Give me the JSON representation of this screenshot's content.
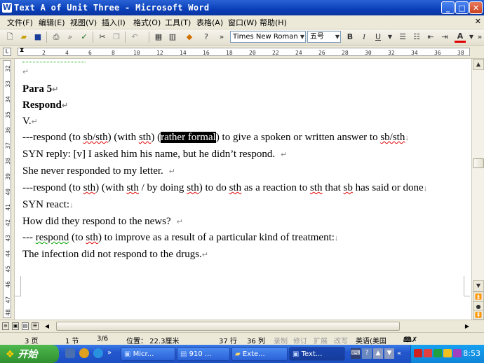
{
  "window": {
    "title": "Text A of Unit Three - Microsoft Word",
    "app_icon": "W",
    "minimize": "_",
    "maximize": "□",
    "close": "✕"
  },
  "menu": [
    "文件(F)",
    "编辑(E)",
    "视图(V)",
    "插入(I)",
    "格式(O)",
    "工具(T)",
    "表格(A)",
    "窗口(W)",
    "帮助(H)"
  ],
  "menu_close": "✕",
  "toolbar": {
    "font_name": "Times New Roman",
    "font_size": "五号",
    "bold": "B",
    "italic": "I",
    "underline": "U",
    "font_color": "A"
  },
  "ruler": {
    "ticks": [
      "2",
      "4",
      "6",
      "8",
      "10",
      "12",
      "14",
      "16",
      "18",
      "20",
      "22",
      "24",
      "26",
      "28",
      "30",
      "32",
      "34",
      "36",
      "38"
    ],
    "vticks": [
      "32",
      "33",
      "34",
      "35",
      "36",
      "37",
      "38",
      "39",
      "40",
      "41",
      "42",
      "43",
      "44",
      "45",
      "46",
      "47",
      "48"
    ]
  },
  "document": {
    "para_heading": "Para 5",
    "word_heading": "Respond",
    "pos": "V.",
    "def1_a": "---respond (to ",
    "def1_b": "sb/sth",
    "def1_c": ") (with ",
    "def1_d": "sth",
    "def1_e": ") (",
    "def1_sel": "rather formal",
    "def1_f": ") to give a spoken or written answer to ",
    "def1_g": "sb/sth",
    "syn1": " SYN   reply: [v] I asked him his name, but he didn’t respond.",
    "ex1": "She never responded to my letter.",
    "def2_a": "---respond (to ",
    "def2_b": "sth",
    "def2_c": ") (with ",
    "def2_d": "sth",
    "def2_e": " / by doing ",
    "def2_f": "sth",
    "def2_g": ") to do ",
    "def2_h": "sth",
    "def2_i": " as a reaction to ",
    "def2_j": "sth",
    "def2_k": " that ",
    "def2_l": "sb",
    "def2_m": " has said or done",
    "syn2": " SYN   react:",
    "ex2": "How did they respond to the news?",
    "def3_a": "--- ",
    "def3_b": "respond",
    "def3_c": " (to ",
    "def3_d": "sth",
    "def3_e": ") to improve as a result of a particular kind of treatment:",
    "ex3": "The infection did not respond to the drugs.",
    "para_mark": "↵",
    "line_mark": "↓"
  },
  "status": {
    "page": "3 页",
    "section": "1 节",
    "page_of": "3/6",
    "position": "位置： 22.3厘米",
    "line": "37 行",
    "column": "36 列",
    "rec": "录制",
    "trk": "修订",
    "ext": "扩展",
    "ovr": "改写",
    "language": "英语(美国"
  },
  "taskbar": {
    "start": "开始",
    "tasks": [
      "Micr...",
      "910 ...",
      "Exte...",
      "Text..."
    ],
    "clock": "8:53"
  },
  "colors": {
    "titlebar": "#0a3fb8",
    "start_green": "#2f8f2f",
    "tray_blue": "#0f85d8",
    "spell_red": "#e00000"
  }
}
